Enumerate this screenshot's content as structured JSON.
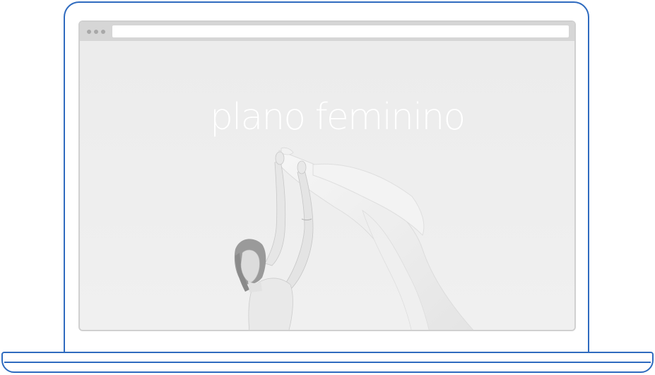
{
  "page": {
    "device": "laptop-mockup",
    "accent_color": "#2f6bbf"
  },
  "browser": {
    "address_value": "",
    "window_controls": [
      "dot",
      "dot",
      "dot"
    ]
  },
  "hero": {
    "logo_text": "plano feminino",
    "image": "woman-with-flowing-fabric"
  }
}
